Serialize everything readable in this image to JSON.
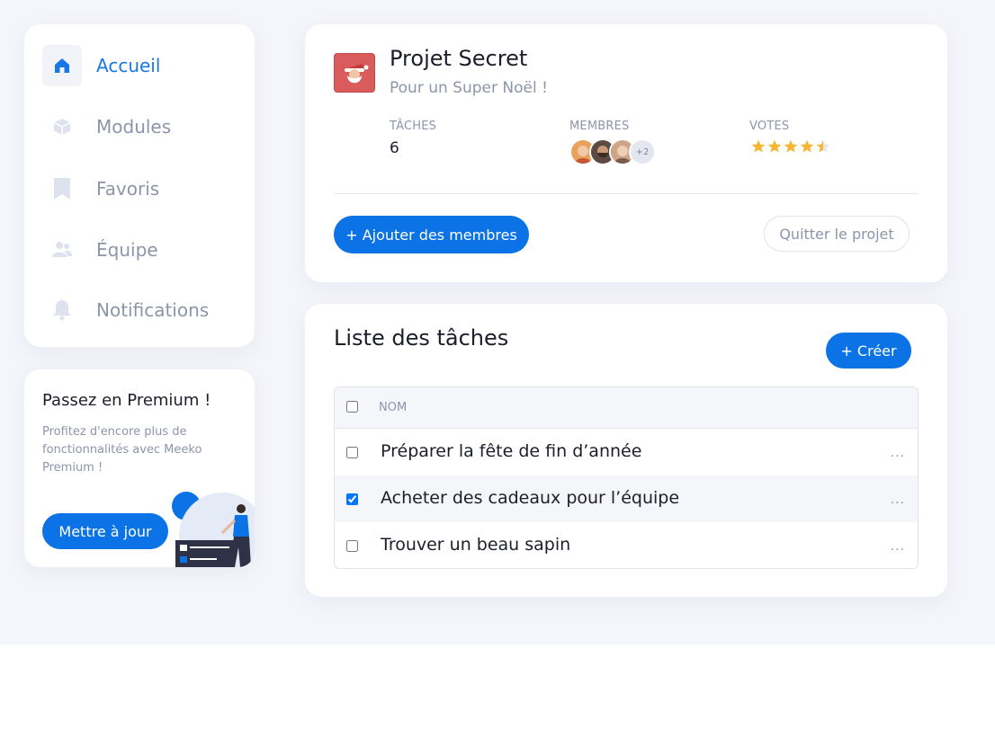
{
  "sidebar": {
    "items": [
      {
        "label": "Accueil",
        "icon": "home-icon",
        "active": true
      },
      {
        "label": "Modules",
        "icon": "cube-icon"
      },
      {
        "label": "Favoris",
        "icon": "bookmark-icon"
      },
      {
        "label": "Équipe",
        "icon": "team-icon"
      },
      {
        "label": "Notifications",
        "icon": "bell-icon"
      }
    ]
  },
  "premium": {
    "title": "Passez en Premium !",
    "text": "Profitez d'encore plus de fonctionnalités avec Meeko Premium !",
    "button": "Mettre à jour"
  },
  "project": {
    "title": "Projet Secret",
    "subtitle": "Pour un Super Noël !",
    "stats": {
      "tasks_label": "TÂCHES",
      "tasks_value": "6",
      "members_label": "MEMBRES",
      "members_more": "+2",
      "votes_label": "VOTES",
      "votes_rating": 4.5,
      "votes_max": 5
    },
    "add_members_button": "+ Ajouter des membres",
    "quit_button": "Quitter le projet"
  },
  "tasks": {
    "title": "Liste des tâches",
    "create_button": "+ Créer",
    "column_name": "NOM",
    "rows": [
      {
        "label": "Préparer la fête de fin d’année",
        "checked": false
      },
      {
        "label": "Acheter des cadeaux pour l’équipe",
        "checked": true
      },
      {
        "label": "Trouver un beau sapin",
        "checked": false
      }
    ],
    "row_more": "..."
  },
  "colors": {
    "accent": "#0b73e6",
    "background": "#f5f6fb",
    "muted_text": "#8d95aa",
    "star": "#f5b731"
  }
}
